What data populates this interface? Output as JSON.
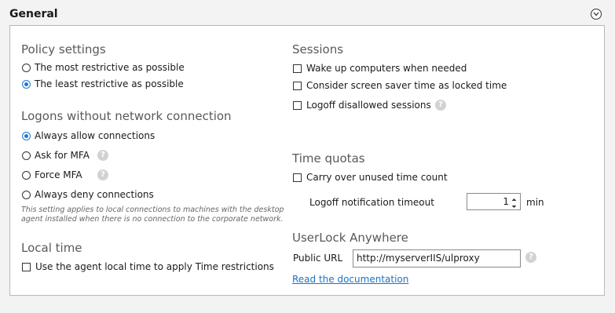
{
  "section_title": "General",
  "policy": {
    "title": "Policy settings",
    "options": [
      "The most restrictive as possible",
      "The least restrictive as possible"
    ],
    "selected": 1
  },
  "logons": {
    "title": "Logons without network connection",
    "options": [
      "Always allow connections",
      "Ask for MFA",
      "Force MFA",
      "Always deny connections"
    ],
    "selected": 0,
    "note": "This setting applies to local connections to machines with the desktop agent installed when there is no connection to the corporate network."
  },
  "local_time": {
    "title": "Local time",
    "checkbox_label": "Use the agent local time to apply Time restrictions"
  },
  "sessions": {
    "title": "Sessions",
    "checkboxes": [
      "Wake up computers when needed",
      "Consider screen saver time as locked time",
      "Logoff disallowed sessions"
    ]
  },
  "time_quotas": {
    "title": "Time quotas",
    "checkbox_label": "Carry over unused time count",
    "timeout_label": "Logoff notification timeout",
    "timeout_value": "1",
    "timeout_unit": "min"
  },
  "anywhere": {
    "title": "UserLock Anywhere",
    "url_label": "Public URL",
    "url_value": "http://myserverIIS/ulproxy",
    "doc_link": "Read the documentation"
  },
  "help_glyph": "?",
  "colors": {
    "accent": "#1e7ad6",
    "link": "#1a73c7",
    "help_bg": "#d2d2d2"
  }
}
